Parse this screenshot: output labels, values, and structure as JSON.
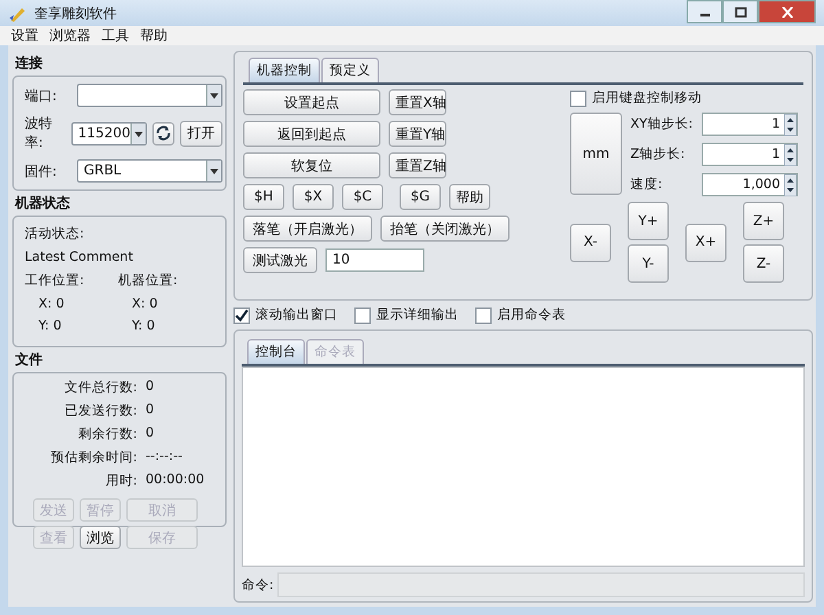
{
  "window": {
    "title": "奎享雕刻软件"
  },
  "menu": [
    {
      "label": "设置"
    },
    {
      "label": "浏览器"
    },
    {
      "label": "工具"
    },
    {
      "label": "帮助"
    }
  ],
  "connection": {
    "title": "连接",
    "port": {
      "label": "端口:"
    },
    "baud": {
      "label": "波特率:",
      "value": "115200"
    },
    "open_button": "打开",
    "firmware": {
      "label": "固件:",
      "value": "GRBL"
    }
  },
  "machine_status": {
    "title": "机器状态",
    "active_state_label": "活动状态:",
    "comment_label": "Latest Comment",
    "work_position": {
      "label": "工作位置:",
      "x": "X: 0",
      "y": "Y: 0"
    },
    "machine_position": {
      "label": "机器位置:",
      "x": "X: 0",
      "y": "Y: 0"
    }
  },
  "file": {
    "title": "文件",
    "stats": [
      {
        "label": "文件总行数:",
        "value": "0"
      },
      {
        "label": "已发送行数:",
        "value": "0"
      },
      {
        "label": "剩余行数:",
        "value": "0"
      },
      {
        "label": "预估剩余时间:",
        "value": "--:--:--"
      },
      {
        "label": "用时:",
        "value": "00:00:00"
      }
    ],
    "buttons": [
      {
        "label": "发送",
        "disabled": true
      },
      {
        "label": "暂停",
        "disabled": true
      },
      {
        "label": "取消",
        "disabled": true
      },
      {
        "label": "查看",
        "disabled": true
      },
      {
        "label": "浏览",
        "disabled": false
      },
      {
        "label": "保存",
        "disabled": true
      }
    ]
  },
  "control_tabs": [
    {
      "label": "机器控制",
      "selected": true
    },
    {
      "label": "预定义",
      "selected": false
    }
  ],
  "machine_control": {
    "position_buttons": [
      {
        "wide": "设置起点",
        "axis": "重置X轴"
      },
      {
        "wide": "返回到起点",
        "axis": "重置Y轴"
      },
      {
        "wide": "软复位",
        "axis": "重置Z轴"
      }
    ],
    "command_buttons": [
      "$H",
      "$X",
      "$C",
      "$G",
      "帮助"
    ],
    "laser_buttons": [
      "落笔（开启激光）",
      "抬笔（关闭激光）"
    ],
    "test_laser": {
      "label": "测试激光",
      "value": "10"
    },
    "keyboard_checkbox": {
      "label": "启用键盘控制移动",
      "checked": false
    },
    "unit_button": "mm",
    "steps": [
      {
        "label": "XY轴步长:",
        "value": "1"
      },
      {
        "label": "Z轴步长:",
        "value": "1"
      },
      {
        "label": "速度:",
        "value": "1,000"
      }
    ],
    "jog": {
      "x_minus": "X-",
      "y_plus": "Y+",
      "y_minus": "Y-",
      "x_plus": "X+",
      "z_plus": "Z+",
      "z_minus": "Z-"
    }
  },
  "output_options": [
    {
      "label": "滚动输出窗口",
      "checked": true
    },
    {
      "label": "显示详细输出",
      "checked": false
    },
    {
      "label": "启用命令表",
      "checked": false
    }
  ],
  "console_tabs": [
    {
      "label": "控制台",
      "selected": true,
      "disabled": false
    },
    {
      "label": "命令表",
      "selected": false,
      "disabled": true
    }
  ],
  "command": {
    "label": "命令:"
  }
}
